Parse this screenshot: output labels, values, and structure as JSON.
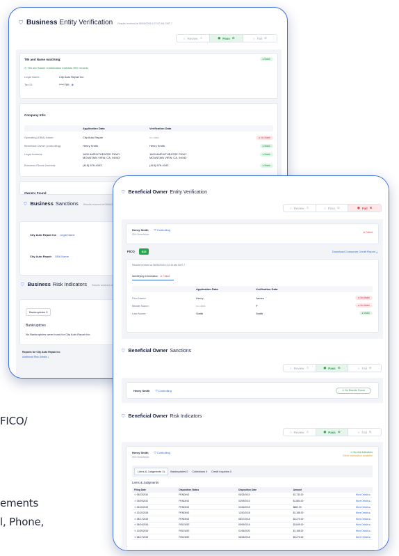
{
  "background": {
    "lines": [
      "FICO/",
      "ements",
      "l, Phone,"
    ]
  },
  "card1": {
    "title_bold": "Business",
    "title_rest": "Entity Verification",
    "received": "Results received at 05/06/2026 4:57:57 AM GMT-7",
    "status_buttons": [
      "Review",
      "Pass",
      "Fail"
    ],
    "tin": {
      "heading": "TIN and Name matching:",
      "badge": "Match",
      "note": "TIN and Name combination matches IRS records",
      "legal_name_label": "Legal Name:",
      "legal_name": "City Auto Repair Inc",
      "tax_id_label": "Tax ID:",
      "tax_id": "*****789"
    },
    "company": {
      "heading": "Company Info:",
      "col_app": "Application Data",
      "col_ver": "Verification Data",
      "rows": [
        {
          "label": "Operating (DBA) Name:",
          "app": "City Auto Repair",
          "ver": "no data",
          "badge": "No Match",
          "ok": false
        },
        {
          "label": "Beneficial Owner (controlling):",
          "app": "Henry Smith",
          "ver": "Henry Smith",
          "badge": "Match",
          "ok": true
        },
        {
          "label": "Legal Address:",
          "app": "1600 AMPHITHEATRE PKWY\nMOUNTAIN VIEW, CA, 94043",
          "ver": "1600 AMPHITHEATRE PKWY\nMOUNTAIN VIEW, CA, 94043",
          "badge": "Match",
          "ok": true
        },
        {
          "label": "Business Phone Number:",
          "app": "(415) 676-4343",
          "ver": "(415) 676-4343",
          "badge": "Match",
          "ok": true
        }
      ]
    },
    "owners_found": "Owners Found",
    "sanctions": {
      "title_bold": "Business",
      "title_rest": "Sanctions",
      "received": "Results received at 05/06/2026",
      "rows": [
        {
          "name": "City Auto Repair Inc",
          "type": "Legal Name"
        },
        {
          "name": "City Auto Repair",
          "type": "DBA Name"
        }
      ]
    },
    "risk": {
      "title_bold": "Business",
      "title_rest": "Risk Indicators",
      "received": "Results received at 05/06/2026",
      "tab": "Bankruptcies",
      "tab_count": "0",
      "section": "Bankruptcies",
      "none": "No Bankruptcies were found for City Auto Repair Inc",
      "reports": "Reports for City Auto Repair Inc",
      "additional": "Additional Risk Details"
    }
  },
  "card2": {
    "entity": {
      "title_bold": "Beneficial Owner",
      "title_rest": "Entity Verification",
      "status_buttons": [
        "Review",
        "Pass",
        "Fail"
      ],
      "owner": "Henry Smith",
      "share": "60% Shareholder",
      "role": "Controlling",
      "failed": "Failed",
      "fico_label": "FICO",
      "fico_score": "815",
      "download": "Download Consumer Credit Report",
      "received": "Results received at 05/06/2026 4:22:16 AM GMT-7",
      "tab": "Identifying Information",
      "tab_status": "Failed",
      "col_app": "Application Data",
      "col_ver": "Verification Data",
      "rows": [
        {
          "label": "First Name:",
          "app": "Henry",
          "ver": "James",
          "badge": "No Match",
          "ok": false
        },
        {
          "label": "Middle Name:",
          "app": "no data",
          "ver": "P",
          "badge": "No Match",
          "ok": false
        },
        {
          "label": "Last Name:",
          "app": "Smith",
          "ver": "Smith",
          "badge": "Match",
          "ok": true
        }
      ]
    },
    "sanctions": {
      "title_bold": "Beneficial Owner",
      "title_rest": "Sanctions",
      "status_buttons": [
        "Review",
        "Pass",
        "Fail"
      ],
      "owner": "Henry Smith",
      "role": "Controlling",
      "result": "No Results Found"
    },
    "risk": {
      "title_bold": "Beneficial Owner",
      "title_rest": "Risk Indicators",
      "status_buttons": [
        "Review",
        "Pass",
        "Fail"
      ],
      "owner": "Henry Smith",
      "share": "60% Shareholder",
      "role": "Controlling",
      "no_risk": "No risk indicators",
      "other_info": "Other information available",
      "tabs": [
        "Liens & Judgments 11",
        "Bankruptcies 0",
        "Collections 0",
        "Credit Inquiries 0"
      ],
      "section": "Liens & Judgments",
      "columns": [
        "Filing Date",
        "Disposition Status",
        "Disposition Date",
        "Amount",
        ""
      ],
      "rows": [
        [
          "06/23/2010",
          "PENDING",
          "06/23/2010",
          "$1,730.00",
          "More Details"
        ],
        [
          "03/09/2010",
          "PENDING",
          "03/09/2010",
          "$1,884.00",
          "More Details"
        ],
        [
          "02/16/2019",
          "PENDING",
          "02/16/2019",
          "$862.00",
          "More Details"
        ],
        [
          "12/10/2018",
          "PENDING",
          "12/10/2018",
          "$1,188.00",
          "More Details"
        ],
        [
          "08/17/2015",
          "PENDING",
          "08/17/2015",
          "$3,270.00",
          "More Details"
        ],
        [
          "05/04/2016",
          "RELEASE",
          "05/09/2016",
          "$3,649.00",
          "More Details"
        ],
        [
          "12/09/2016",
          "RELEASE",
          "01/06/2020",
          "$1,188.00",
          "More Details"
        ],
        [
          "06/17/2015",
          "RELEASE",
          "06/18/2018",
          "$3,270.00",
          "More Details"
        ]
      ]
    }
  }
}
